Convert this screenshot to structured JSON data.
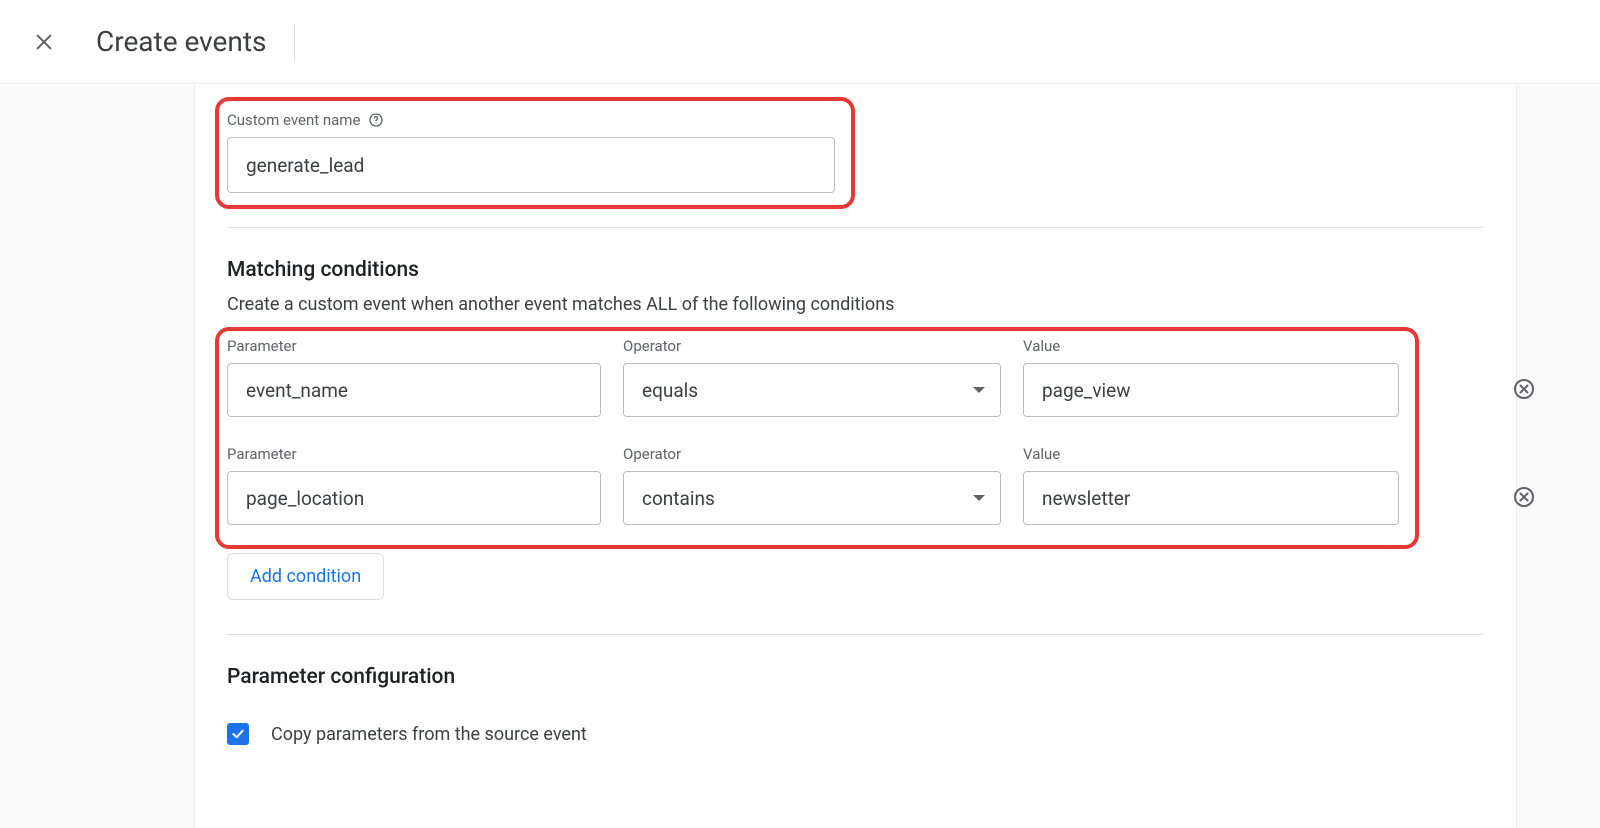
{
  "header": {
    "title": "Create events"
  },
  "config": {
    "custom_event_label": "Custom event name",
    "custom_event_value": "generate_lead"
  },
  "matching": {
    "title": "Matching conditions",
    "subtitle": "Create a custom event when another event matches ALL of the following conditions",
    "columns": {
      "parameter": "Parameter",
      "operator": "Operator",
      "value": "Value"
    },
    "rows": [
      {
        "parameter": "event_name",
        "operator": "equals",
        "value": "page_view"
      },
      {
        "parameter": "page_location",
        "operator": "contains",
        "value": "newsletter"
      }
    ],
    "add_condition_label": "Add condition"
  },
  "param_config": {
    "title": "Parameter configuration",
    "copy_params_label": "Copy parameters from the source event",
    "copy_params_checked": true
  }
}
